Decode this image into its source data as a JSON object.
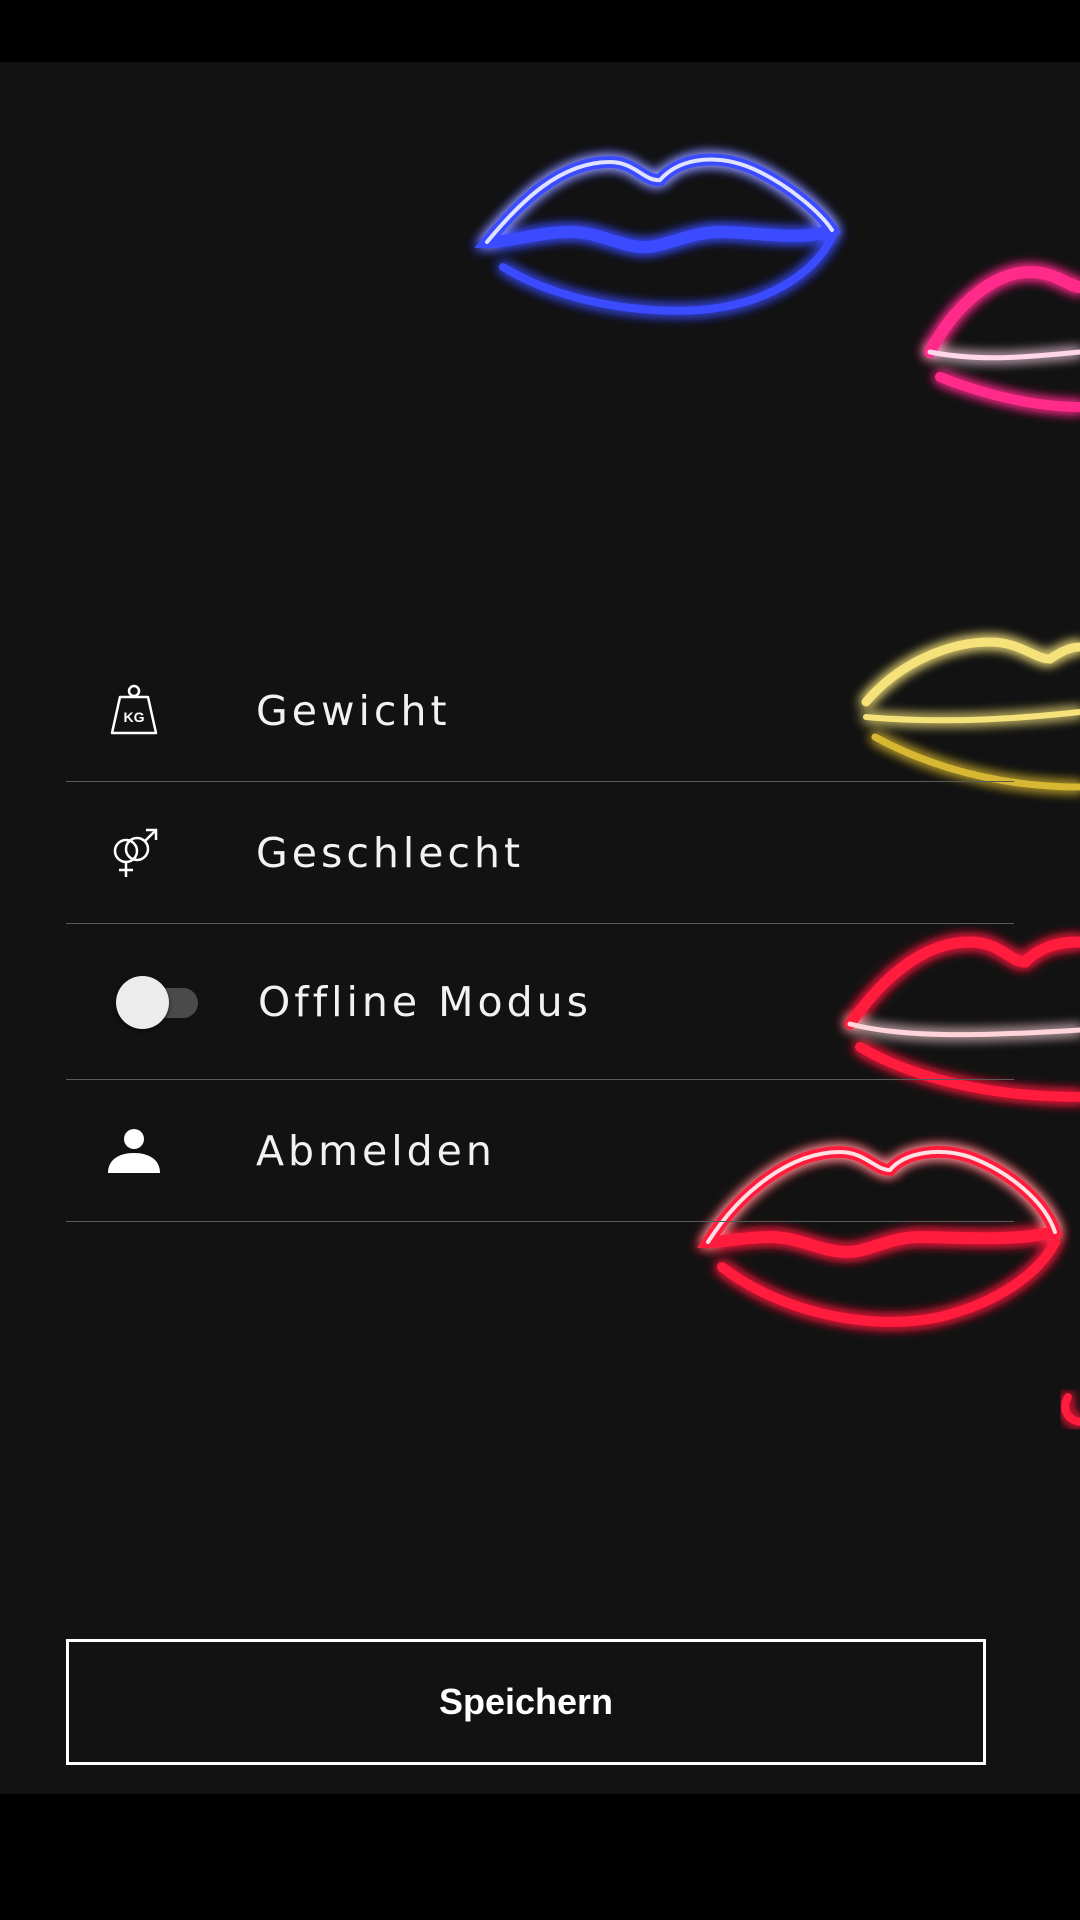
{
  "settings": {
    "items": [
      {
        "icon": "weight-kg-icon",
        "label": "Gewicht",
        "icon_text": "KG"
      },
      {
        "icon": "gender-icon",
        "label": "Geschlecht"
      },
      {
        "icon": "toggle-switch",
        "label": "Offline Modus",
        "toggle_on": false
      },
      {
        "icon": "person-icon",
        "label": "Abmelden"
      }
    ]
  },
  "save_button": {
    "label": "Speichern"
  },
  "colors": {
    "background": "#121212",
    "text": "#f2f2f2",
    "divider": "#5a5a5a",
    "neon_blue": "#3b4bff",
    "neon_pink": "#ff2a8a",
    "neon_yellow": "#f5e27a",
    "neon_red": "#ff1a3c"
  }
}
